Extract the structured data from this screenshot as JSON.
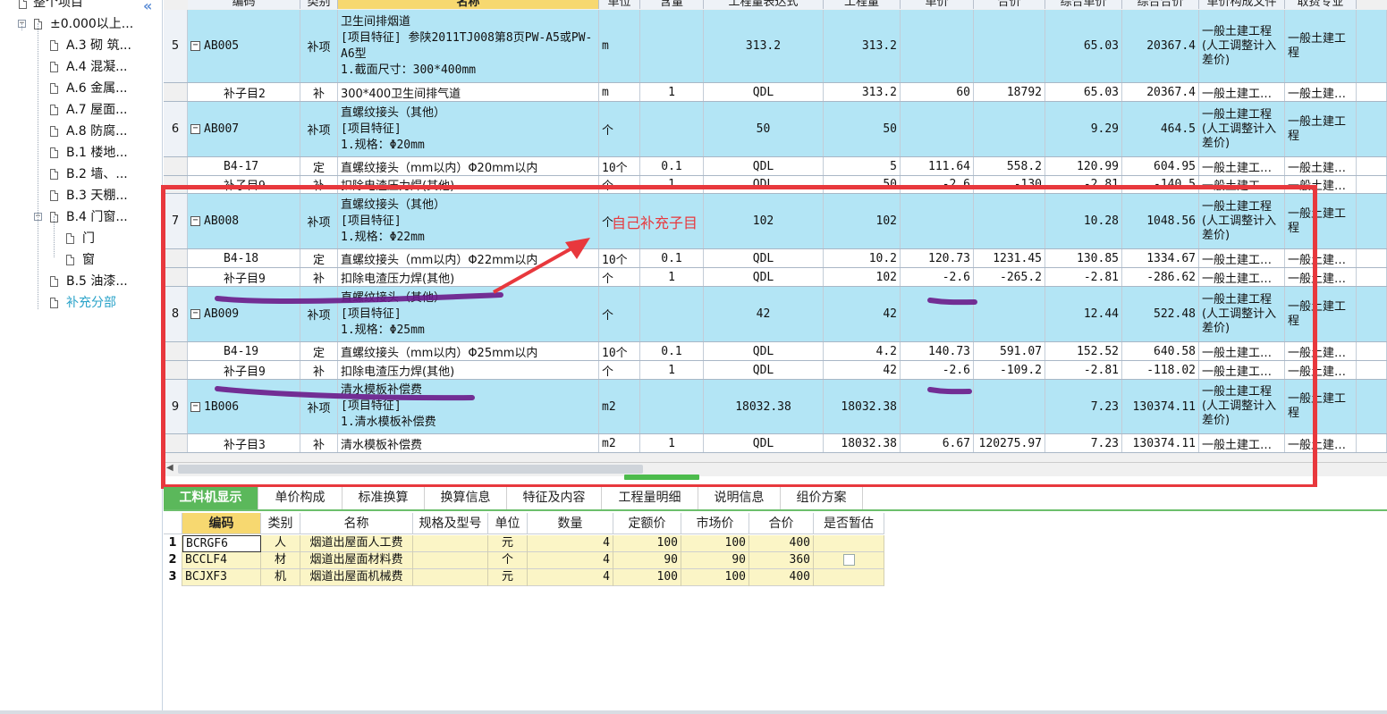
{
  "tree": {
    "root_label": "整个项目",
    "items": [
      {
        "label": "±0.000以上...",
        "expander": "−"
      },
      {
        "label": "A.3 砌 筑..."
      },
      {
        "label": "A.4 混凝..."
      },
      {
        "label": "A.6 金属..."
      },
      {
        "label": "A.7 屋面..."
      },
      {
        "label": "A.8 防腐..."
      },
      {
        "label": "B.1 楼地..."
      },
      {
        "label": "B.2 墙、..."
      },
      {
        "label": "B.3 天棚..."
      },
      {
        "label": "B.4 门窗...",
        "expander": "−"
      },
      {
        "label": "门"
      },
      {
        "label": "窗"
      },
      {
        "label": "B.5 油漆..."
      },
      {
        "label": "补充分部"
      }
    ],
    "collapse_glyph": "«",
    "accent_color": "#2aa3c9"
  },
  "grid": {
    "headers": [
      "编码",
      "类别",
      "名称",
      "单位",
      "含量",
      "工程量表达式",
      "工程量",
      "单价",
      "合价",
      "综合单价",
      "综合合价",
      "单价构成文件",
      "取费专业"
    ],
    "rows": [
      {
        "type": "main",
        "num": "5",
        "code": "AB005",
        "cat": "补项",
        "name_lines": [
          "卫生间排烟道",
          "[项目特征]  参陕2011TJ008第8页PW-A5或PW-A6型",
          "1.截面尺寸：300*400mm"
        ],
        "unit": "m",
        "content": "",
        "expr": "313.2",
        "qty": "313.2",
        "price": "",
        "total": "",
        "comp_price": "65.03",
        "comp_total": "20367.4",
        "file": "一般土建工程(人工调整计入差价)",
        "fee": "一般土建工程"
      },
      {
        "type": "sub",
        "num": "",
        "code": "补子目2",
        "cat": "补",
        "name_lines": [
          "300*400卫生间排气道"
        ],
        "unit": "m",
        "content": "1",
        "expr": "QDL",
        "qty": "313.2",
        "price": "60",
        "total": "18792",
        "comp_price": "65.03",
        "comp_total": "20367.4",
        "file": "一般土建工…",
        "fee": "一般土建…"
      },
      {
        "type": "main",
        "num": "6",
        "code": "AB007",
        "cat": "补项",
        "name_lines": [
          "直螺纹接头（其他）",
          "[项目特征]",
          "1.规格：Φ20mm"
        ],
        "unit": "个",
        "content": "",
        "expr": "50",
        "qty": "50",
        "price": "",
        "total": "",
        "comp_price": "9.29",
        "comp_total": "464.5",
        "file": "一般土建工程(人工调整计入差价)",
        "fee": "一般土建工程"
      },
      {
        "type": "sub",
        "num": "",
        "code": "B4-17",
        "cat": "定",
        "name_lines": [
          "直螺纹接头（mm以内）Φ20mm以内"
        ],
        "unit": "10个",
        "content": "0.1",
        "expr": "QDL",
        "qty": "5",
        "price": "111.64",
        "total": "558.2",
        "comp_price": "120.99",
        "comp_total": "604.95",
        "file": "一般土建工…",
        "fee": "一般土建…"
      },
      {
        "type": "sub",
        "num": "",
        "code": "补子目9",
        "cat": "补",
        "name_lines": [
          "扣除电渣压力焊(其他)"
        ],
        "unit": "个",
        "content": "1",
        "expr": "QDL",
        "qty": "50",
        "price": "-2.6",
        "total": "-130",
        "comp_price": "-2.81",
        "comp_total": "-140.5",
        "file": "一般土建工…",
        "fee": "一般土建…"
      },
      {
        "type": "main",
        "num": "7",
        "code": "AB008",
        "cat": "补项",
        "name_lines": [
          "直螺纹接头（其他）",
          "[项目特征]",
          "1.规格：Φ22mm"
        ],
        "unit": "个",
        "content": "",
        "expr": "102",
        "qty": "102",
        "price": "",
        "total": "",
        "comp_price": "10.28",
        "comp_total": "1048.56",
        "file": "一般土建工程(人工调整计入差价)",
        "fee": "一般土建工程"
      },
      {
        "type": "sub",
        "num": "",
        "code": "B4-18",
        "cat": "定",
        "name_lines": [
          "直螺纹接头（mm以内）Φ22mm以内"
        ],
        "unit": "10个",
        "content": "0.1",
        "expr": "QDL",
        "qty": "10.2",
        "price": "120.73",
        "total": "1231.45",
        "comp_price": "130.85",
        "comp_total": "1334.67",
        "file": "一般土建工…",
        "fee": "一般土建…"
      },
      {
        "type": "sub",
        "num": "",
        "code": "补子目9",
        "cat": "补",
        "name_lines": [
          "扣除电渣压力焊(其他)"
        ],
        "unit": "个",
        "content": "1",
        "expr": "QDL",
        "qty": "102",
        "price": "-2.6",
        "total": "-265.2",
        "comp_price": "-2.81",
        "comp_total": "-286.62",
        "file": "一般土建工…",
        "fee": "一般土建…"
      },
      {
        "type": "main",
        "num": "8",
        "code": "AB009",
        "cat": "补项",
        "name_lines": [
          "直螺纹接头（其他）",
          "[项目特征]",
          "1.规格：Φ25mm"
        ],
        "unit": "个",
        "content": "",
        "expr": "42",
        "qty": "42",
        "price": "",
        "total": "",
        "comp_price": "12.44",
        "comp_total": "522.48",
        "file": "一般土建工程(人工调整计入差价)",
        "fee": "一般土建工程"
      },
      {
        "type": "sub",
        "num": "",
        "code": "B4-19",
        "cat": "定",
        "name_lines": [
          "直螺纹接头（mm以内）Φ25mm以内"
        ],
        "unit": "10个",
        "content": "0.1",
        "expr": "QDL",
        "qty": "4.2",
        "price": "140.73",
        "total": "591.07",
        "comp_price": "152.52",
        "comp_total": "640.58",
        "file": "一般土建工…",
        "fee": "一般土建…"
      },
      {
        "type": "sub",
        "num": "",
        "code": "补子目9",
        "cat": "补",
        "name_lines": [
          "扣除电渣压力焊(其他)"
        ],
        "unit": "个",
        "content": "1",
        "expr": "QDL",
        "qty": "42",
        "price": "-2.6",
        "total": "-109.2",
        "comp_price": "-2.81",
        "comp_total": "-118.02",
        "file": "一般土建工…",
        "fee": "一般土建…"
      },
      {
        "type": "main",
        "num": "9",
        "code": "1B006",
        "cat": "补项",
        "name_lines": [
          "清水模板补偿费",
          "[项目特征]",
          "1.清水模板补偿费"
        ],
        "unit": "m2",
        "content": "",
        "expr": "18032.38",
        "qty": "18032.38",
        "price": "",
        "total": "",
        "comp_price": "7.23",
        "comp_total": "130374.11",
        "file": "一般土建工程(人工调整计入差价)",
        "fee": "一般土建工程"
      },
      {
        "type": "sub",
        "num": "",
        "code": "补子目3",
        "cat": "补",
        "name_lines": [
          "清水模板补偿费"
        ],
        "unit": "m2",
        "content": "1",
        "expr": "QDL",
        "qty": "18032.38",
        "price": "6.67",
        "total": "120275.97",
        "comp_price": "7.23",
        "comp_total": "130374.11",
        "file": "一般土建工…",
        "fee": "一般土建…"
      }
    ]
  },
  "annotation": {
    "note_text": "自己补充子目",
    "box_color": "#e8383d",
    "marker_color": "#6a1a8a"
  },
  "bottom": {
    "tabs": [
      "工料机显示",
      "单价构成",
      "标准换算",
      "换算信息",
      "特征及内容",
      "工程量明细",
      "说明信息",
      "组价方案"
    ],
    "active_tab": 0,
    "headers": [
      "编码",
      "类别",
      "名称",
      "规格及型号",
      "单位",
      "数量",
      "定额价",
      "市场价",
      "合价",
      "是否暂估"
    ],
    "rows": [
      {
        "num": "1",
        "code": "BCRGF6",
        "cat": "人",
        "name": "烟道出屋面人工费",
        "spec": "",
        "unit": "元",
        "qty": "4",
        "base": "100",
        "market": "100",
        "total": "400",
        "temp": false,
        "show_chk": false
      },
      {
        "num": "2",
        "code": "BCCLF4",
        "cat": "材",
        "name": "烟道出屋面材料费",
        "spec": "",
        "unit": "个",
        "qty": "4",
        "base": "90",
        "market": "90",
        "total": "360",
        "temp": false,
        "show_chk": true
      },
      {
        "num": "3",
        "code": "BCJXF3",
        "cat": "机",
        "name": "烟道出屋面机械费",
        "spec": "",
        "unit": "元",
        "qty": "4",
        "base": "100",
        "market": "100",
        "total": "400",
        "temp": false,
        "show_chk": false
      }
    ]
  }
}
